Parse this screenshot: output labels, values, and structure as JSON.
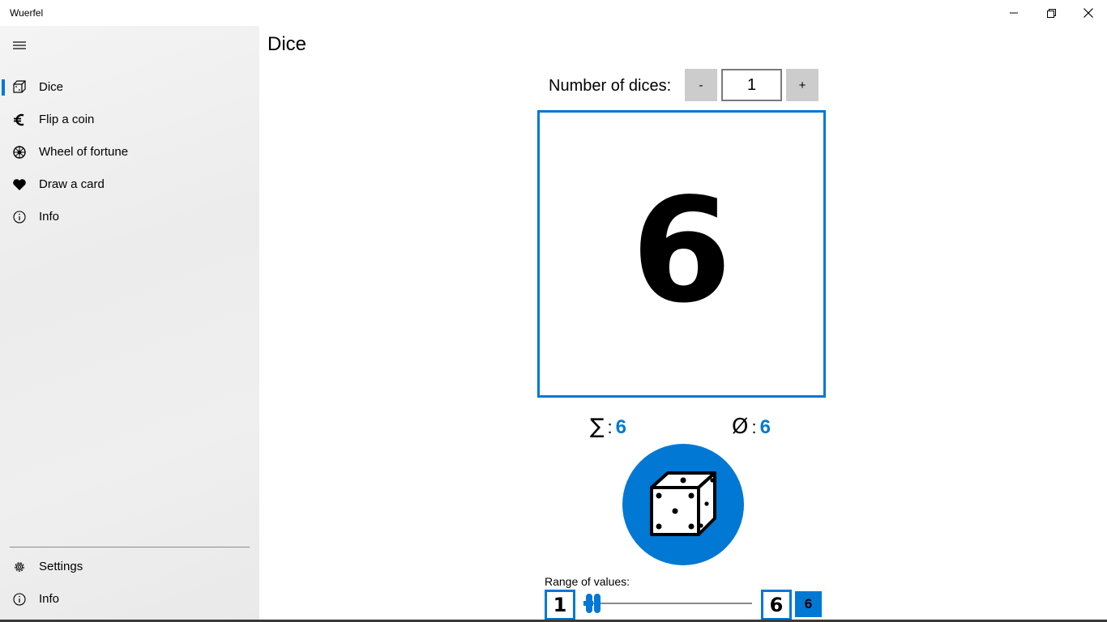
{
  "window": {
    "title": "Wuerfel"
  },
  "sidebar": {
    "items": [
      {
        "label": "Dice",
        "icon": "cube-icon",
        "selected": true
      },
      {
        "label": "Flip a coin",
        "icon": "euro-icon"
      },
      {
        "label": "Wheel of fortune",
        "icon": "wheel-icon"
      },
      {
        "label": "Draw a card",
        "icon": "heart-icon"
      },
      {
        "label": "Info",
        "icon": "info-icon"
      }
    ],
    "footer": [
      {
        "label": "Settings",
        "icon": "gear-icon"
      },
      {
        "label": "Info",
        "icon": "info-icon"
      }
    ]
  },
  "main": {
    "title": "Dice",
    "dice_count": {
      "label": "Number of dices:",
      "value": "1",
      "minus": "-",
      "plus": "+"
    },
    "result": "6",
    "stats": {
      "sum_symbol": "∑",
      "sum": "6",
      "avg_symbol": "Ø",
      "avg": "6",
      "separator": ":"
    },
    "range": {
      "label": "Range of values:",
      "min": "1",
      "max": "6",
      "current": "6"
    }
  },
  "colors": {
    "accent": "#0078d4",
    "sidebar_bg": "#eeeeee",
    "button_gray": "#cccccc"
  }
}
